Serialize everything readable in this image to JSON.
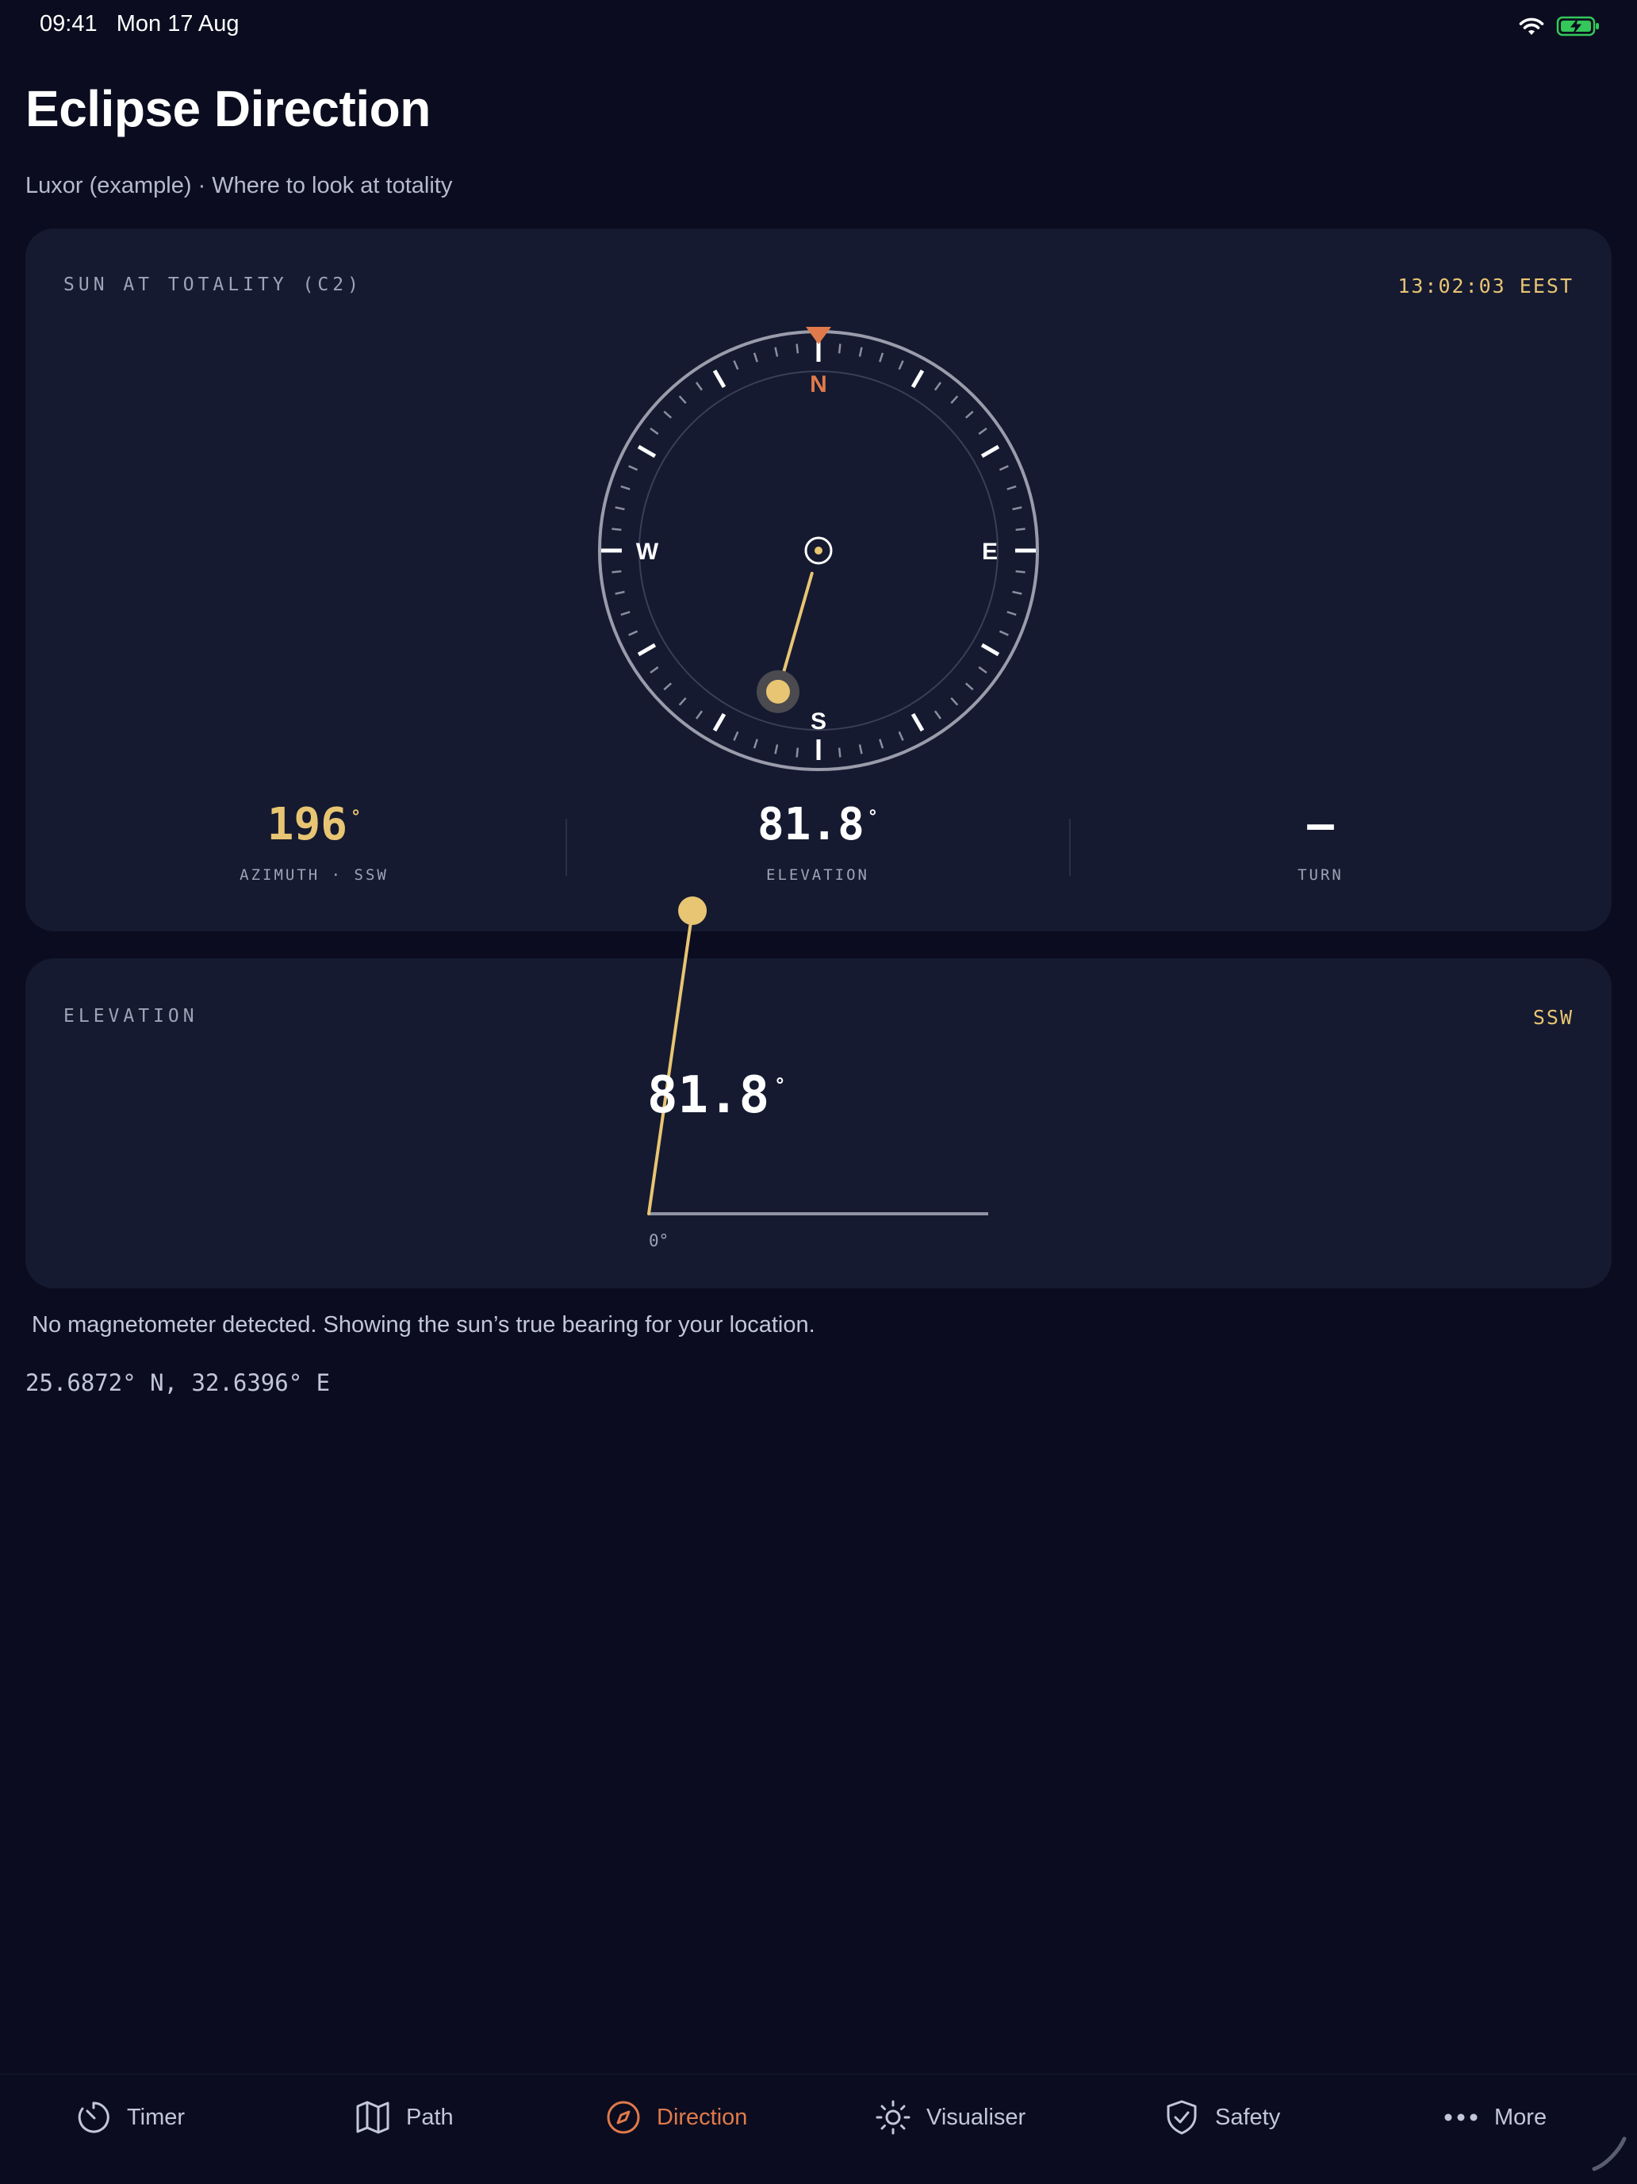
{
  "status_bar": {
    "time": "09:41",
    "date": "Mon 17 Aug"
  },
  "header": {
    "title": "Eclipse Direction",
    "subtitle": "Luxor (example) · Where to look at totality"
  },
  "sun_card": {
    "label": "SUN AT TOTALITY (C2)",
    "time": "13:02:03 EEST",
    "compass": {
      "north": "N",
      "south": "S",
      "east": "E",
      "west": "W",
      "sun_azimuth_deg": 196
    },
    "stats": [
      {
        "value": "196",
        "unit": "°",
        "label": "AZIMUTH · SSW",
        "color": "#e8c572"
      },
      {
        "value": "81.8",
        "unit": "°",
        "label": "ELEVATION",
        "color": "#ffffff"
      },
      {
        "value": "–",
        "unit": "",
        "label": "TURN",
        "color": "#ffffff"
      }
    ]
  },
  "elevation_card": {
    "label": "ELEVATION",
    "direction": "SSW",
    "value": "81.8",
    "unit": "°",
    "zero_label": "0°",
    "elevation_deg": 81.8
  },
  "notice": "No magnetometer detected. Showing the sun’s true bearing for your location.",
  "coordinates": "25.6872° N, 32.6396° E",
  "tabs": [
    {
      "label": "Timer",
      "icon": "timer-icon",
      "active": false
    },
    {
      "label": "Path",
      "icon": "map-icon",
      "active": false
    },
    {
      "label": "Direction",
      "icon": "compass-icon",
      "active": true
    },
    {
      "label": "Visualiser",
      "icon": "sun-icon",
      "active": false
    },
    {
      "label": "Safety",
      "icon": "shield-check-icon",
      "active": false
    },
    {
      "label": "More",
      "icon": "more-dots-icon",
      "active": false
    }
  ],
  "colors": {
    "accent": "#e07a4b",
    "sun": "#e8c572",
    "background": "#0b0c1f",
    "card": "#151a30"
  }
}
